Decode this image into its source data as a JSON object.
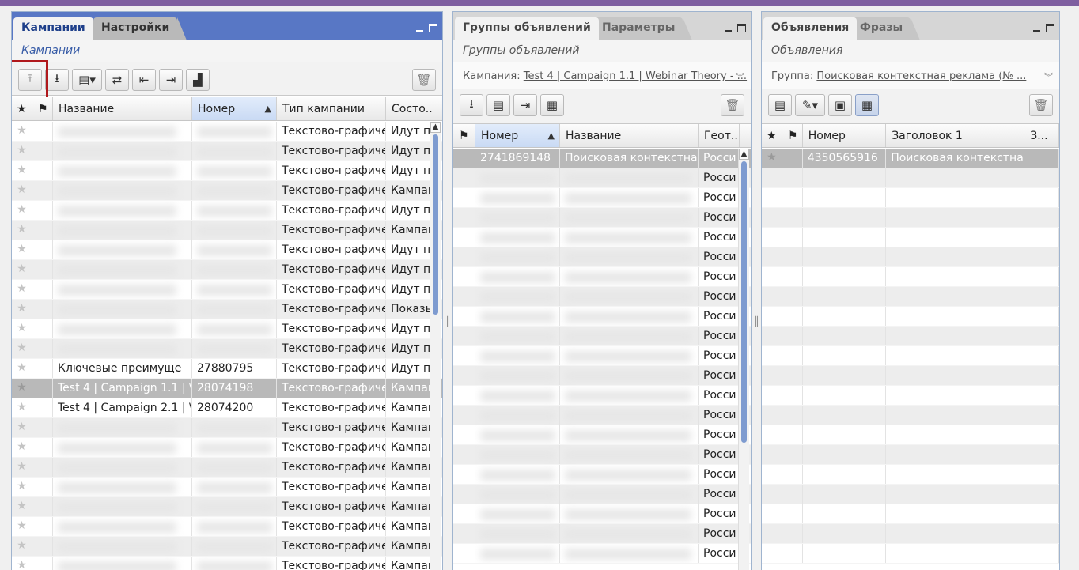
{
  "panels": [
    {
      "tabs": [
        "Кампании",
        "Настройки"
      ],
      "subtitle": "Кампании",
      "headers": [
        "Название",
        "Номер",
        "Тип кампании",
        "Состо..."
      ],
      "rows": [
        {
          "name": "",
          "num": "",
          "type": "Текстово-графиче",
          "status": "Идут по"
        },
        {
          "name": "",
          "num": "",
          "type": "Текстово-графиче",
          "status": "Идут по"
        },
        {
          "name": "",
          "num": "",
          "type": "Текстово-графиче",
          "status": "Идут по"
        },
        {
          "name": "",
          "num": "",
          "type": "Текстово-графиче",
          "status": "Кампан"
        },
        {
          "name": "",
          "num": "",
          "type": "Текстово-графиче",
          "status": "Идут по"
        },
        {
          "name": "",
          "num": "",
          "type": "Текстово-графиче",
          "status": "Кампан"
        },
        {
          "name": "",
          "num": "",
          "type": "Текстово-графиче",
          "status": "Идут по"
        },
        {
          "name": "",
          "num": "",
          "type": "Текстово-графиче",
          "status": "Идут по"
        },
        {
          "name": "",
          "num": "",
          "type": "Текстово-графиче",
          "status": "Идут по"
        },
        {
          "name": "",
          "num": "",
          "type": "Текстово-графиче",
          "status": "Показь"
        },
        {
          "name": "",
          "num": "",
          "type": "Текстово-графиче",
          "status": "Идут по"
        },
        {
          "name": "",
          "num": "",
          "type": "Текстово-графиче",
          "status": "Идут по"
        },
        {
          "name": "Ключевые преимуще",
          "num": "27880795",
          "type": "Текстово-графиче",
          "status": "Идут по"
        },
        {
          "name": "Test 4 | Campaign 1.1 | \\",
          "num": "28074198",
          "type": "Текстово-графиче",
          "status": "Кампан"
        },
        {
          "name": "Test 4 | Campaign 2.1 | \\",
          "num": "28074200",
          "type": "Текстово-графиче",
          "status": "Кампан"
        },
        {
          "name": "",
          "num": "",
          "type": "Текстово-графиче",
          "status": "Кампан"
        },
        {
          "name": "",
          "num": "",
          "type": "Текстово-графиче",
          "status": "Кампан"
        },
        {
          "name": "",
          "num": "",
          "type": "Текстово-графиче",
          "status": "Кампан"
        },
        {
          "name": "",
          "num": "",
          "type": "Текстово-графиче",
          "status": "Кампан"
        },
        {
          "name": "",
          "num": "",
          "type": "Текстово-графиче",
          "status": "Кампан"
        },
        {
          "name": "",
          "num": "",
          "type": "Текстово-графиче",
          "status": "Кампан"
        },
        {
          "name": "",
          "num": "",
          "type": "Текстово-графиче",
          "status": "Кампан"
        },
        {
          "name": "",
          "num": "",
          "type": "Текстово-графиче",
          "status": "Кампан"
        }
      ]
    },
    {
      "tabs": [
        "Группы объявлений",
        "Параметры"
      ],
      "subtitle": "Группы объявлений",
      "crumb_label": "Кампания:",
      "crumb_value": "Test 4 | Campaign 1.1 | Webinar Theory - ...",
      "headers": [
        "Номер",
        "Название",
        "Геот..."
      ],
      "first_row": {
        "num": "2741869148",
        "name": "Поисковая контекстная",
        "geo": "Росси"
      },
      "geo_value": "Росси"
    },
    {
      "tabs": [
        "Объявления",
        "Фразы"
      ],
      "subtitle": "Объявления",
      "crumb_label": "Группа:",
      "crumb_value": "Поисковая контекстная реклама (№ ...",
      "headers": [
        "Номер",
        "Заголовок 1",
        "З..."
      ],
      "first_row": {
        "num": "4350565916",
        "title": "Поисковая контекстна"
      }
    }
  ]
}
